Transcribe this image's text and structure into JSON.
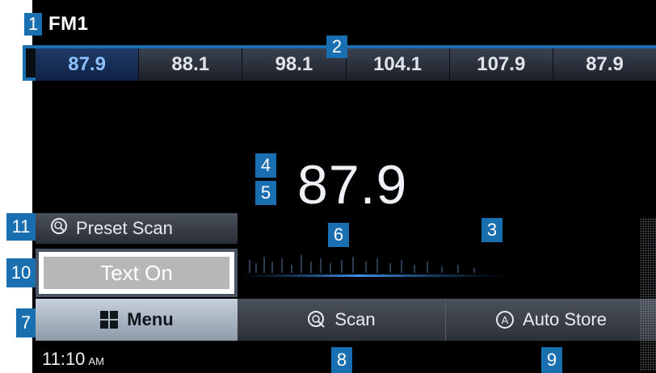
{
  "header": {
    "mode": "FM1"
  },
  "presets": [
    "87.9",
    "88.1",
    "98.1",
    "104.1",
    "107.9",
    "87.9"
  ],
  "current": {
    "frequency": "87.9"
  },
  "side_buttons": {
    "preset_scan": "Preset Scan",
    "text_on": "Text On"
  },
  "bottom": {
    "menu": "Menu",
    "scan": "Scan",
    "auto_store": "Auto Store"
  },
  "status": {
    "time": "11:10",
    "ampm": "AM"
  },
  "callouts": [
    "1",
    "2",
    "3",
    "4",
    "5",
    "6",
    "7",
    "8",
    "9",
    "10",
    "11"
  ],
  "colors": {
    "callout_blue": "#1a6fb0",
    "selected_preset": "#1f3a66",
    "menu_active": "#c7d1dd"
  },
  "icons": {
    "preset_scan": "preset-scan-icon",
    "menu": "grid-icon",
    "scan": "scan-icon",
    "auto_store": "auto-store-icon"
  }
}
